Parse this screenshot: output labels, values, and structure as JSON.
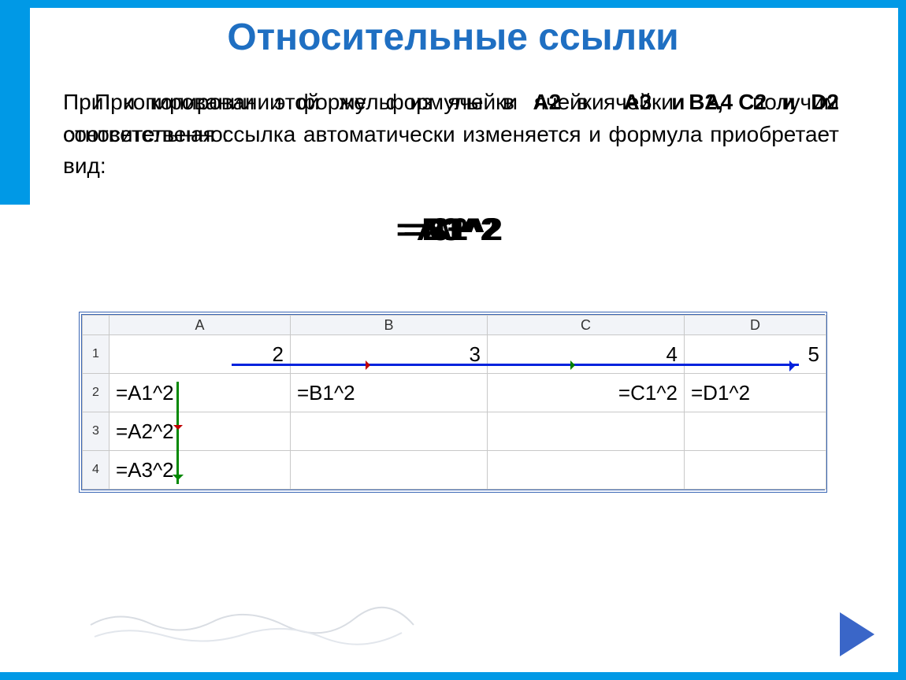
{
  "title": "Относительные ссылки",
  "paragraph": {
    "line1_a": "При копировании формулы из ячейки ",
    "cell_a2": "А2",
    "line1_b": " в ячейки ",
    "cells_bcd": "B2, С2 и D2",
    "line1_c": " относительная ссылка автоматически изменяется и формула приобретает вид:",
    "overlay_a": "При копировании этой же формулы в ячейки ",
    "overlay_cells": "A3 и A4",
    "overlay_b": " получим соответственно:"
  },
  "formula_overlays": [
    "=B1^2",
    "=C1^2",
    "=D1^2",
    "=A2^2",
    "=A3^2"
  ],
  "sheet": {
    "columns": [
      "A",
      "B",
      "C",
      "D"
    ],
    "rows": [
      "1",
      "2",
      "3",
      "4"
    ],
    "r1": {
      "A": "2",
      "B": "3",
      "C": "4",
      "D": "5"
    },
    "r2": {
      "A": "=А1^2",
      "B": "=В1^2",
      "C": "=С1^2",
      "D": "=D1^2"
    },
    "r3": {
      "A": "=А2^2"
    },
    "r4": {
      "A": "=А3^2"
    }
  },
  "nav": {
    "next": "next-slide"
  }
}
